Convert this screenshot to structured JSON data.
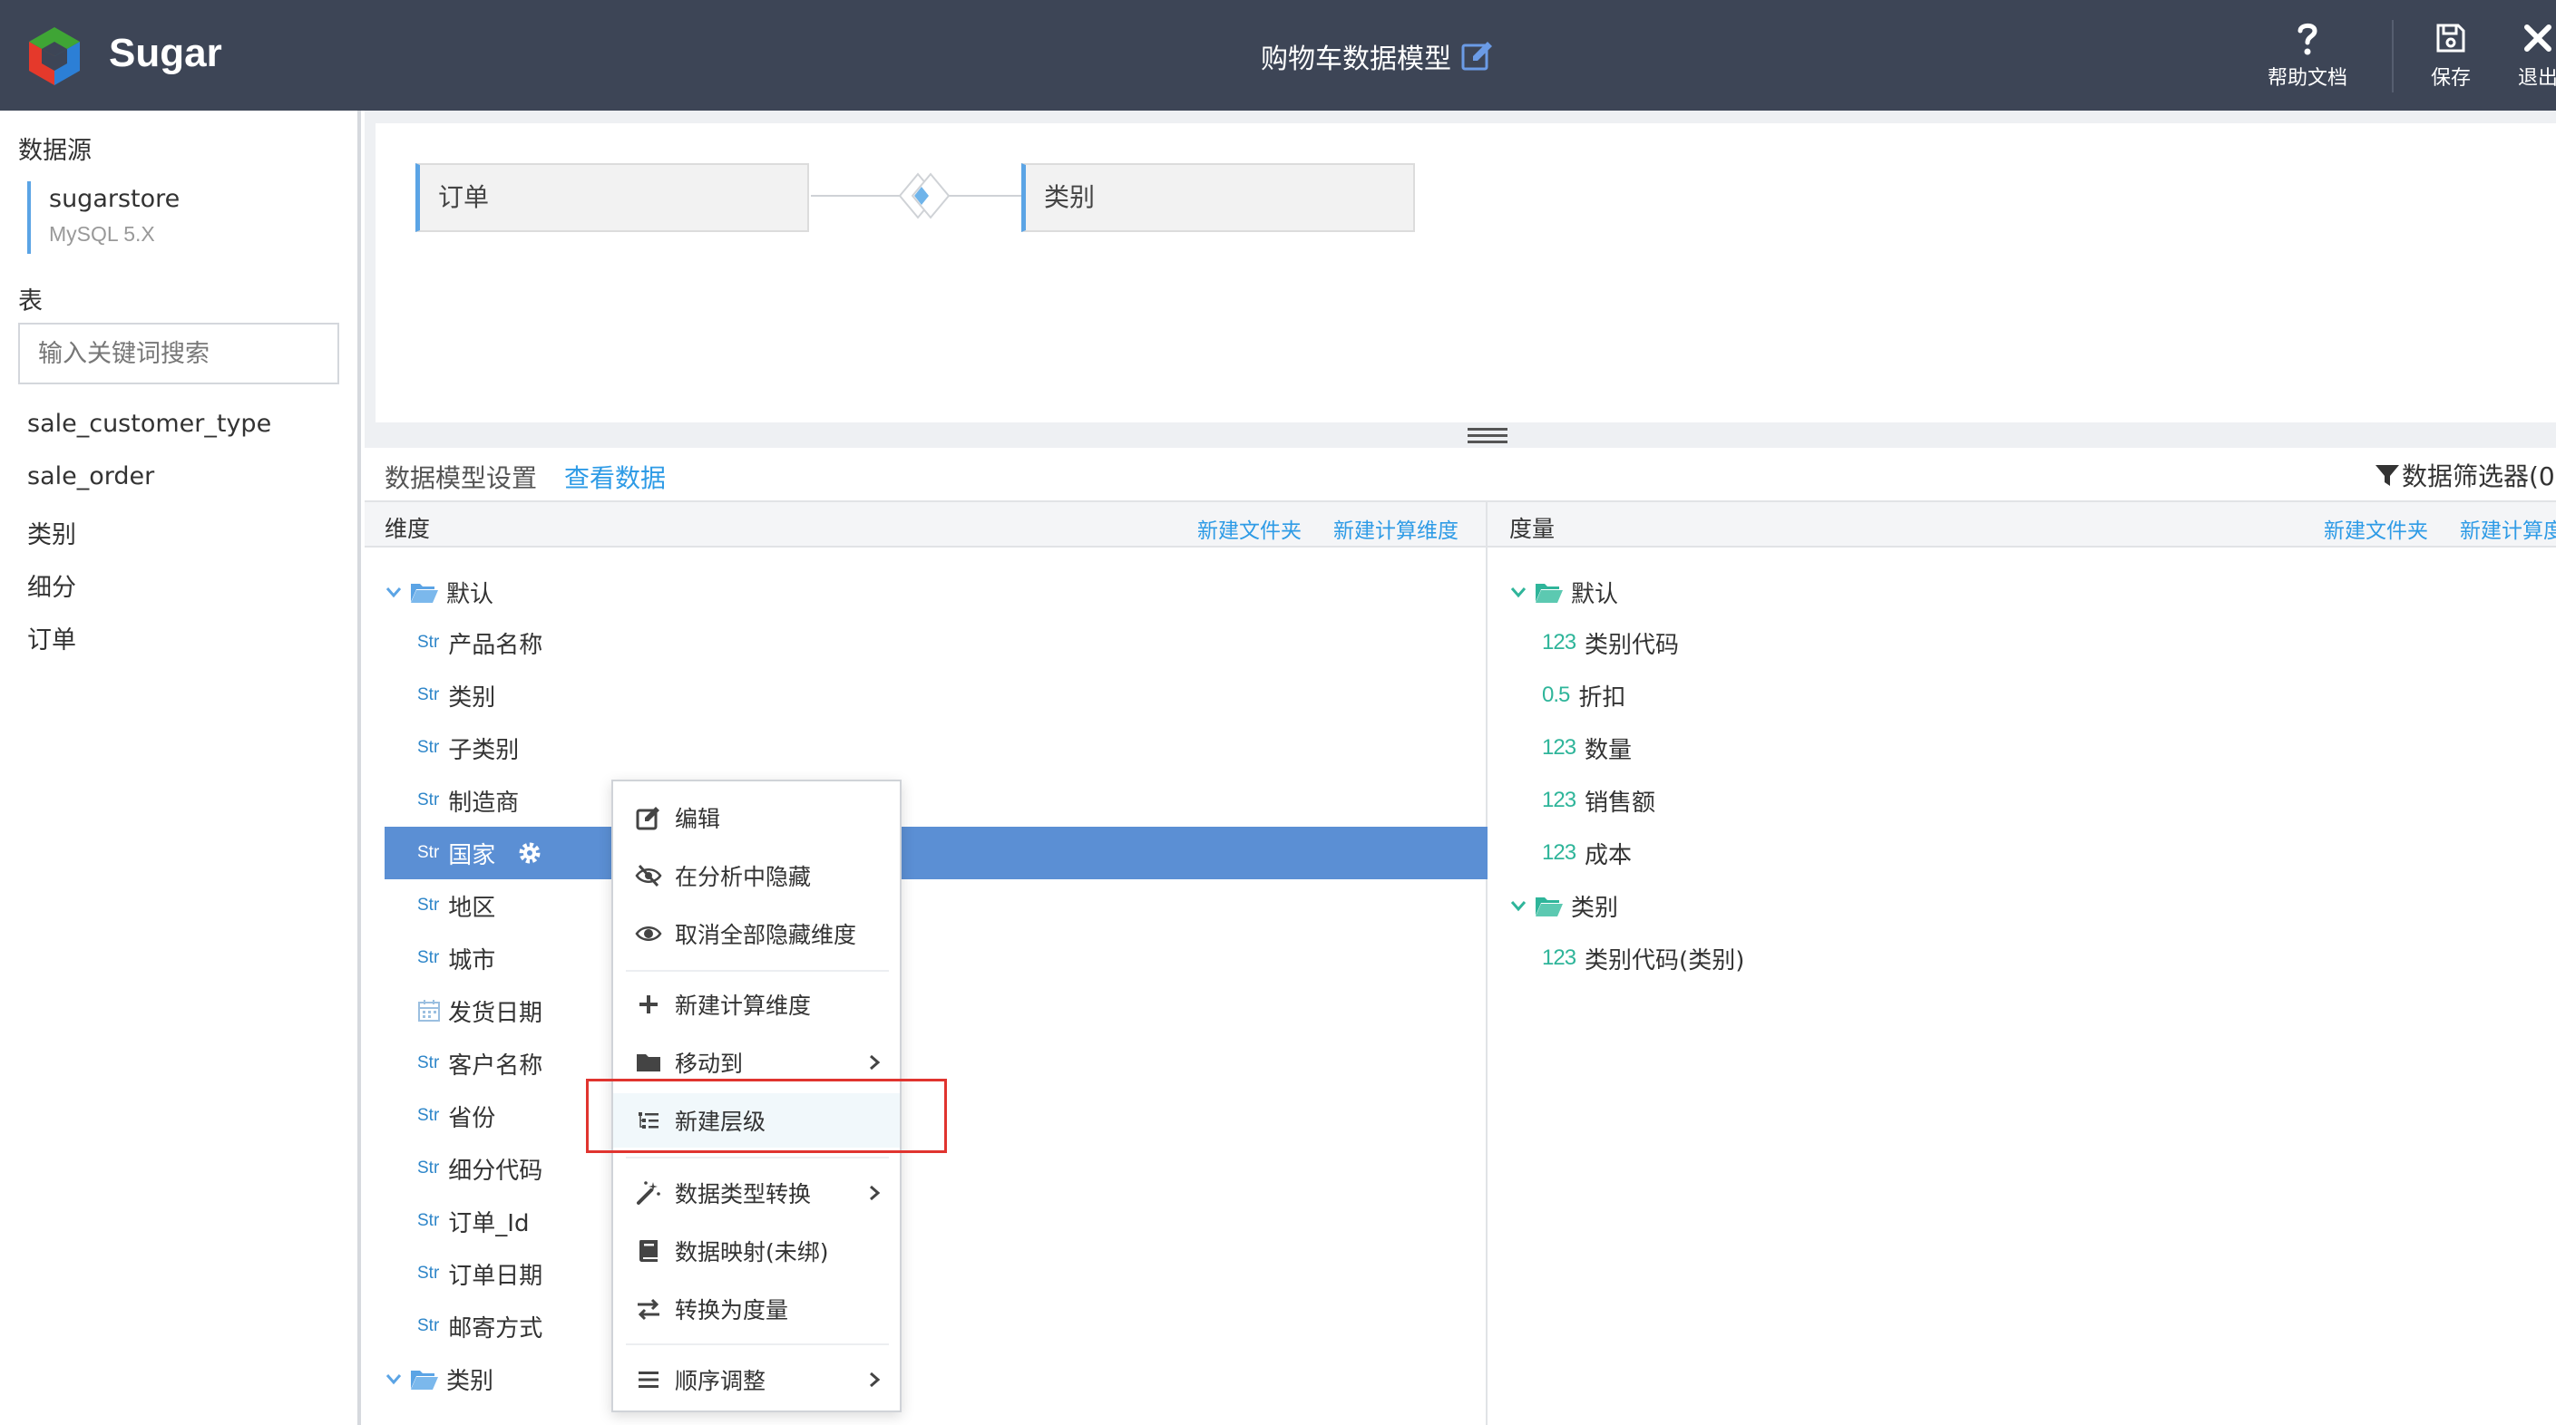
{
  "header": {
    "brand": "Sugar",
    "title": "购物车数据模型",
    "buttons": {
      "help": "帮助文档",
      "save": "保存",
      "exit": "退出"
    }
  },
  "sidebar": {
    "datasource_label": "数据源",
    "datasource": {
      "name": "sugarstore",
      "type": "MySQL 5.X"
    },
    "table_label": "表",
    "search_placeholder": "输入关键词搜索",
    "tables": [
      "sale_customer_type",
      "sale_order",
      "类别",
      "细分",
      "订单"
    ]
  },
  "diagram": {
    "left_node": "订单",
    "right_node": "类别"
  },
  "tabs": {
    "settings": "数据模型设置",
    "view_data": "查看数据"
  },
  "filter": {
    "label": "数据筛选器(0"
  },
  "dimensions": {
    "header": "维度",
    "actions": {
      "new_folder": "新建文件夹",
      "new_calc": "新建计算维度"
    },
    "folder_default": "默认",
    "items": [
      {
        "type": "Str",
        "label": "产品名称"
      },
      {
        "type": "Str",
        "label": "类别"
      },
      {
        "type": "Str",
        "label": "子类别"
      },
      {
        "type": "Str",
        "label": "制造商"
      },
      {
        "type": "Str",
        "label": "国家"
      },
      {
        "type": "Str",
        "label": "地区"
      },
      {
        "type": "Str",
        "label": "城市"
      },
      {
        "type": "date",
        "label": "发货日期"
      },
      {
        "type": "Str",
        "label": "客户名称"
      },
      {
        "type": "Str",
        "label": "省份"
      },
      {
        "type": "Str",
        "label": "细分代码"
      },
      {
        "type": "Str",
        "label": "订单_Id"
      },
      {
        "type": "Str",
        "label": "订单日期"
      },
      {
        "type": "Str",
        "label": "邮寄方式"
      }
    ],
    "folder_category": "类别"
  },
  "measures": {
    "header": "度量",
    "actions": {
      "new_folder": "新建文件夹",
      "new_calc": "新建计算度"
    },
    "folder_default": "默认",
    "items": [
      {
        "type": "123",
        "label": "类别代码"
      },
      {
        "type": "0.5",
        "label": "折扣"
      },
      {
        "type": "123",
        "label": "数量"
      },
      {
        "type": "123",
        "label": "销售额"
      },
      {
        "type": "123",
        "label": "成本"
      }
    ],
    "folder_category": "类别",
    "category_items": [
      {
        "type": "123",
        "label": "类别代码(类别)"
      }
    ]
  },
  "context_menu": {
    "items": [
      {
        "icon": "edit-icon",
        "label": "编辑"
      },
      {
        "icon": "eye-slash-icon",
        "label": "在分析中隐藏"
      },
      {
        "icon": "eye-icon",
        "label": "取消全部隐藏维度"
      },
      {
        "icon": "plus-icon",
        "label": "新建计算维度"
      },
      {
        "icon": "folder-icon",
        "label": "移动到"
      },
      {
        "icon": "hierarchy-icon",
        "label": "新建层级"
      },
      {
        "icon": "magic-wand-icon",
        "label": "数据类型转换"
      },
      {
        "icon": "book-icon",
        "label": "数据映射(未绑)"
      },
      {
        "icon": "swap-icon",
        "label": "转换为度量"
      },
      {
        "icon": "list-icon",
        "label": "顺序调整"
      }
    ]
  },
  "colors": {
    "header_bg": "#3d4556",
    "accent_blue": "#2e9be6",
    "selected_row": "#5b8fd4",
    "measure_green": "#2fb59a",
    "highlight_red": "#e0342f"
  }
}
